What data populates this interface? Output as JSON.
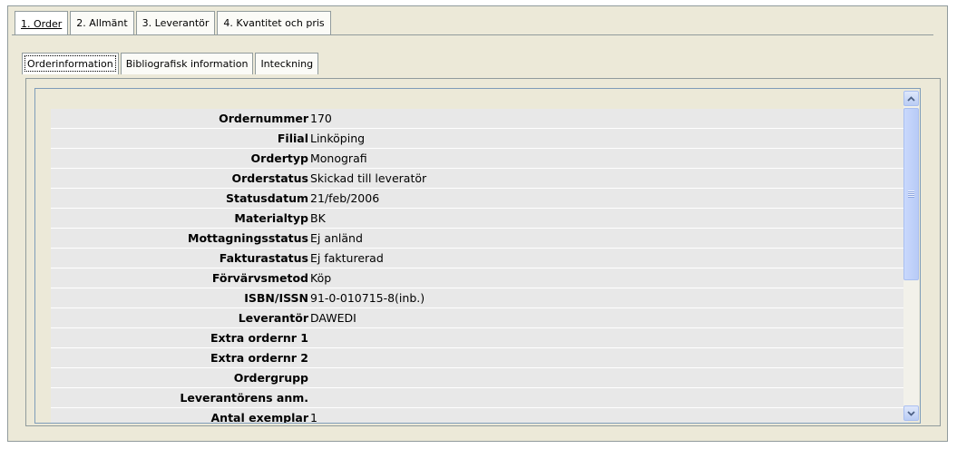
{
  "main_tabs": [
    {
      "label": "1. Order",
      "active": true
    },
    {
      "label": "2. Allmänt",
      "active": false
    },
    {
      "label": "3. Leverantör",
      "active": false
    },
    {
      "label": "4. Kvantitet och pris",
      "active": false
    }
  ],
  "sub_tabs": [
    {
      "label": "Orderinformation",
      "active": true
    },
    {
      "label": "Bibliografisk information",
      "active": false
    },
    {
      "label": "Inteckning",
      "active": false
    }
  ],
  "fields": [
    {
      "label": "Ordernummer",
      "value": "170"
    },
    {
      "label": "Filial",
      "value": "Linköping"
    },
    {
      "label": "Ordertyp",
      "value": "Monografi"
    },
    {
      "label": "Orderstatus",
      "value": "Skickad till leveratör"
    },
    {
      "label": "Statusdatum",
      "value": "21/feb/2006"
    },
    {
      "label": "Materialtyp",
      "value": "BK"
    },
    {
      "label": "Mottagningsstatus",
      "value": "Ej anländ"
    },
    {
      "label": "Fakturastatus",
      "value": "Ej fakturerad"
    },
    {
      "label": "Förvärvsmetod",
      "value": "Köp"
    },
    {
      "label": "ISBN/ISSN",
      "value": "91-0-010715-8(inb.)"
    },
    {
      "label": "Leverantör",
      "value": "DAWEDI"
    },
    {
      "label": "Extra ordernr 1",
      "value": ""
    },
    {
      "label": "Extra ordernr 2",
      "value": ""
    },
    {
      "label": "Ordergrupp",
      "value": ""
    },
    {
      "label": "Leverantörens anm.",
      "value": ""
    },
    {
      "label": "Antal exemplar",
      "value": "1"
    }
  ],
  "icons": {
    "scroll_up": "chevron-up-icon",
    "scroll_down": "chevron-down-icon"
  },
  "colors": {
    "panel_bg": "#ece9d8",
    "row_bg": "#e8e8e8",
    "tab_border": "#919b9c",
    "scrollbar_accent": "#b9ccf4"
  }
}
